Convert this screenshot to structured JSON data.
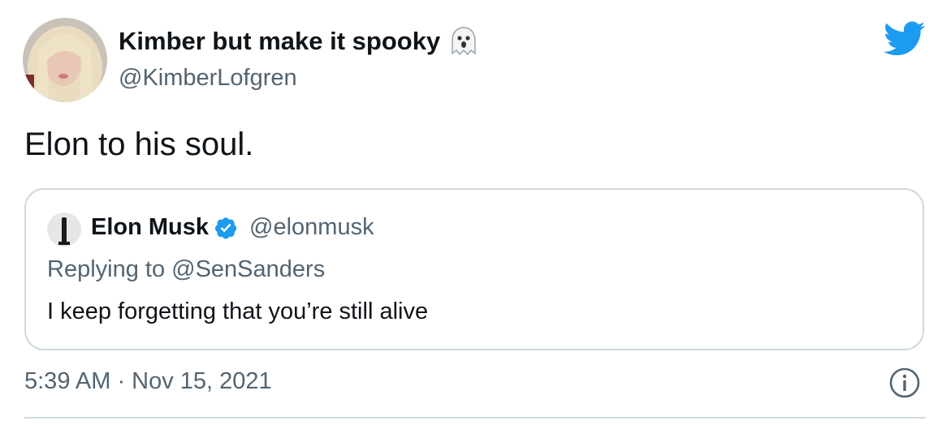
{
  "tweet": {
    "display_name": "Kimber but make it spooky",
    "handle": "@KimberLofgren",
    "name_emoji_icon": "ghost-icon",
    "brand_icon": "twitter-bird-icon",
    "text": "Elon to his soul.",
    "timestamp": "5:39 AM · Nov 15, 2021"
  },
  "quote": {
    "name": "Elon Musk",
    "verified_icon": "verified-badge-icon",
    "handle": "@elonmusk",
    "replying_to": "Replying to @SenSanders",
    "text": "I keep forgetting that you’re still alive"
  },
  "colors": {
    "text_primary": "#0f1419",
    "text_secondary": "#536471",
    "twitter_blue": "#1d9bf0",
    "border": "#cfd9de"
  }
}
